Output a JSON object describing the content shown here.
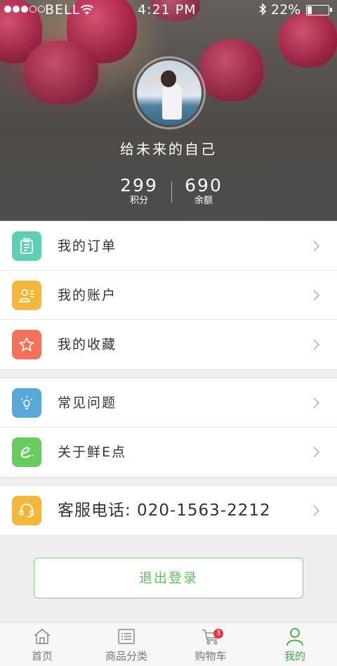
{
  "status_bar": {
    "carrier": "BELL",
    "time": "4:21 PM",
    "battery_text": "22%",
    "battery_level": 0.22
  },
  "profile": {
    "username": "给未来的自己",
    "points_value": "299",
    "points_label": "积分",
    "balance_value": "690",
    "balance_label": "余额"
  },
  "menu": {
    "group1": [
      {
        "label": "我的订单",
        "icon": "clipboard-icon",
        "color": "#5fcfb4"
      },
      {
        "label": "我的账户",
        "icon": "account-card-icon",
        "color": "#f4b73c"
      },
      {
        "label": "我的收藏",
        "icon": "star-icon",
        "color": "#f4715a"
      }
    ],
    "group2": [
      {
        "label": "常见问题",
        "icon": "lightbulb-icon",
        "color": "#58a9d8"
      },
      {
        "label": "关于鲜E点",
        "icon": "e-logo-icon",
        "color": "#67cc5d"
      }
    ],
    "group3": [
      {
        "label": "客服电话: 020-1563-2212",
        "icon": "headset-icon",
        "color": "#f4b73c"
      }
    ]
  },
  "logout_label": "退出登录",
  "tabbar": {
    "tabs": [
      {
        "label": "首页",
        "icon": "home-icon"
      },
      {
        "label": "商品分类",
        "icon": "list-icon"
      },
      {
        "label": "购物车",
        "icon": "cart-icon",
        "badge": "3"
      },
      {
        "label": "我的",
        "icon": "user-icon"
      }
    ],
    "active_index": 3,
    "active_color": "#42a642"
  }
}
